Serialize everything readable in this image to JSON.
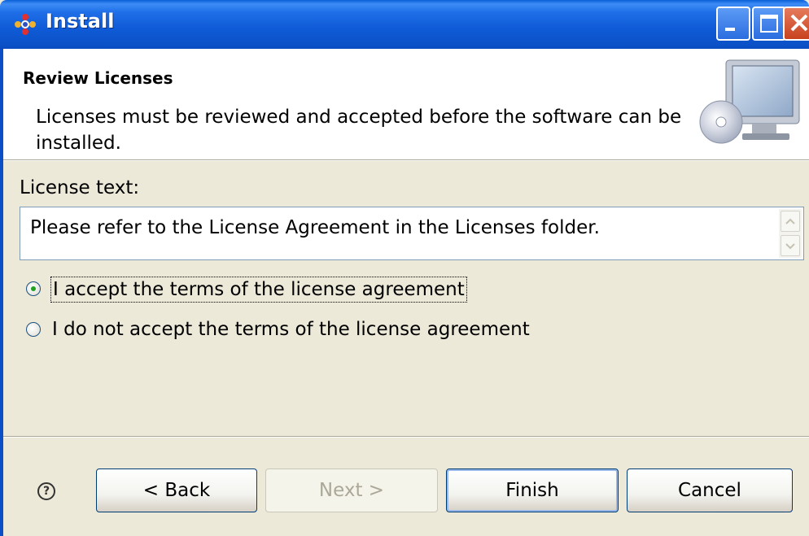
{
  "window": {
    "title": "Install",
    "icon": "install-wizard-icon",
    "controls": [
      "minimize-icon",
      "maximize-icon",
      "close-icon"
    ]
  },
  "header": {
    "title": "Review Licenses",
    "description": "Licenses must be reviewed and accepted before the software can be installed.",
    "image": "computer-with-cd-icon"
  },
  "license": {
    "label": "License text:",
    "text": "Please refer to the License Agreement in the Licenses folder."
  },
  "radios": [
    {
      "label": "I accept the terms of the license agreement",
      "selected": true
    },
    {
      "label": "I do not accept the terms of the license agreement",
      "selected": false
    }
  ],
  "buttons": {
    "back": "< Back",
    "next": "Next >",
    "finish": "Finish",
    "cancel": "Cancel",
    "help": "?"
  },
  "colors": {
    "titlebar": "#0a52c8",
    "dialog_bg": "#ece9d8",
    "radio_selected": "#21a121"
  }
}
